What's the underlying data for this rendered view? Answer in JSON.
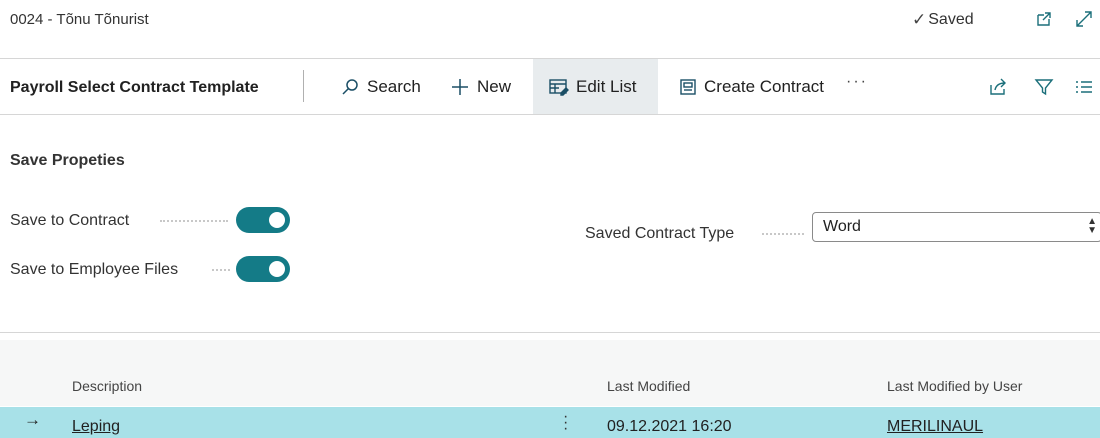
{
  "header": {
    "record_title": "0024 - Tõnu Tõnurist",
    "saved_label": "Saved",
    "icons": [
      "check-icon",
      "open-new-window-icon",
      "expand-icon"
    ]
  },
  "actionbar": {
    "page_name": "Payroll Select Contract Template",
    "actions": [
      {
        "label": "Search",
        "icon": "search-icon"
      },
      {
        "label": "New",
        "icon": "plus-icon"
      },
      {
        "label": "Edit List",
        "icon": "edit-list-icon",
        "active": true
      },
      {
        "label": "Create Contract",
        "icon": "document-icon"
      }
    ],
    "more": "···",
    "right_icons": [
      "share-icon",
      "filter-icon",
      "list-view-icon"
    ]
  },
  "fields": {
    "group_title": "Save Propeties",
    "save_to_contract": {
      "label": "Save to Contract",
      "value": true
    },
    "save_to_employee_files": {
      "label": "Save to Employee Files",
      "value": true
    },
    "saved_contract_type": {
      "label": "Saved Contract Type",
      "value": "Word"
    }
  },
  "list": {
    "columns": [
      "Description",
      "Last Modified",
      "Last Modified by User"
    ],
    "rows": [
      {
        "description": "Leping",
        "last_modified": "09.12.2021 16:20",
        "user": "MERILINAUL",
        "selected": true
      }
    ]
  },
  "colors": {
    "accent": "#147b87",
    "selected_row": "#a8e1e8",
    "active_action": "#e8ecee"
  }
}
